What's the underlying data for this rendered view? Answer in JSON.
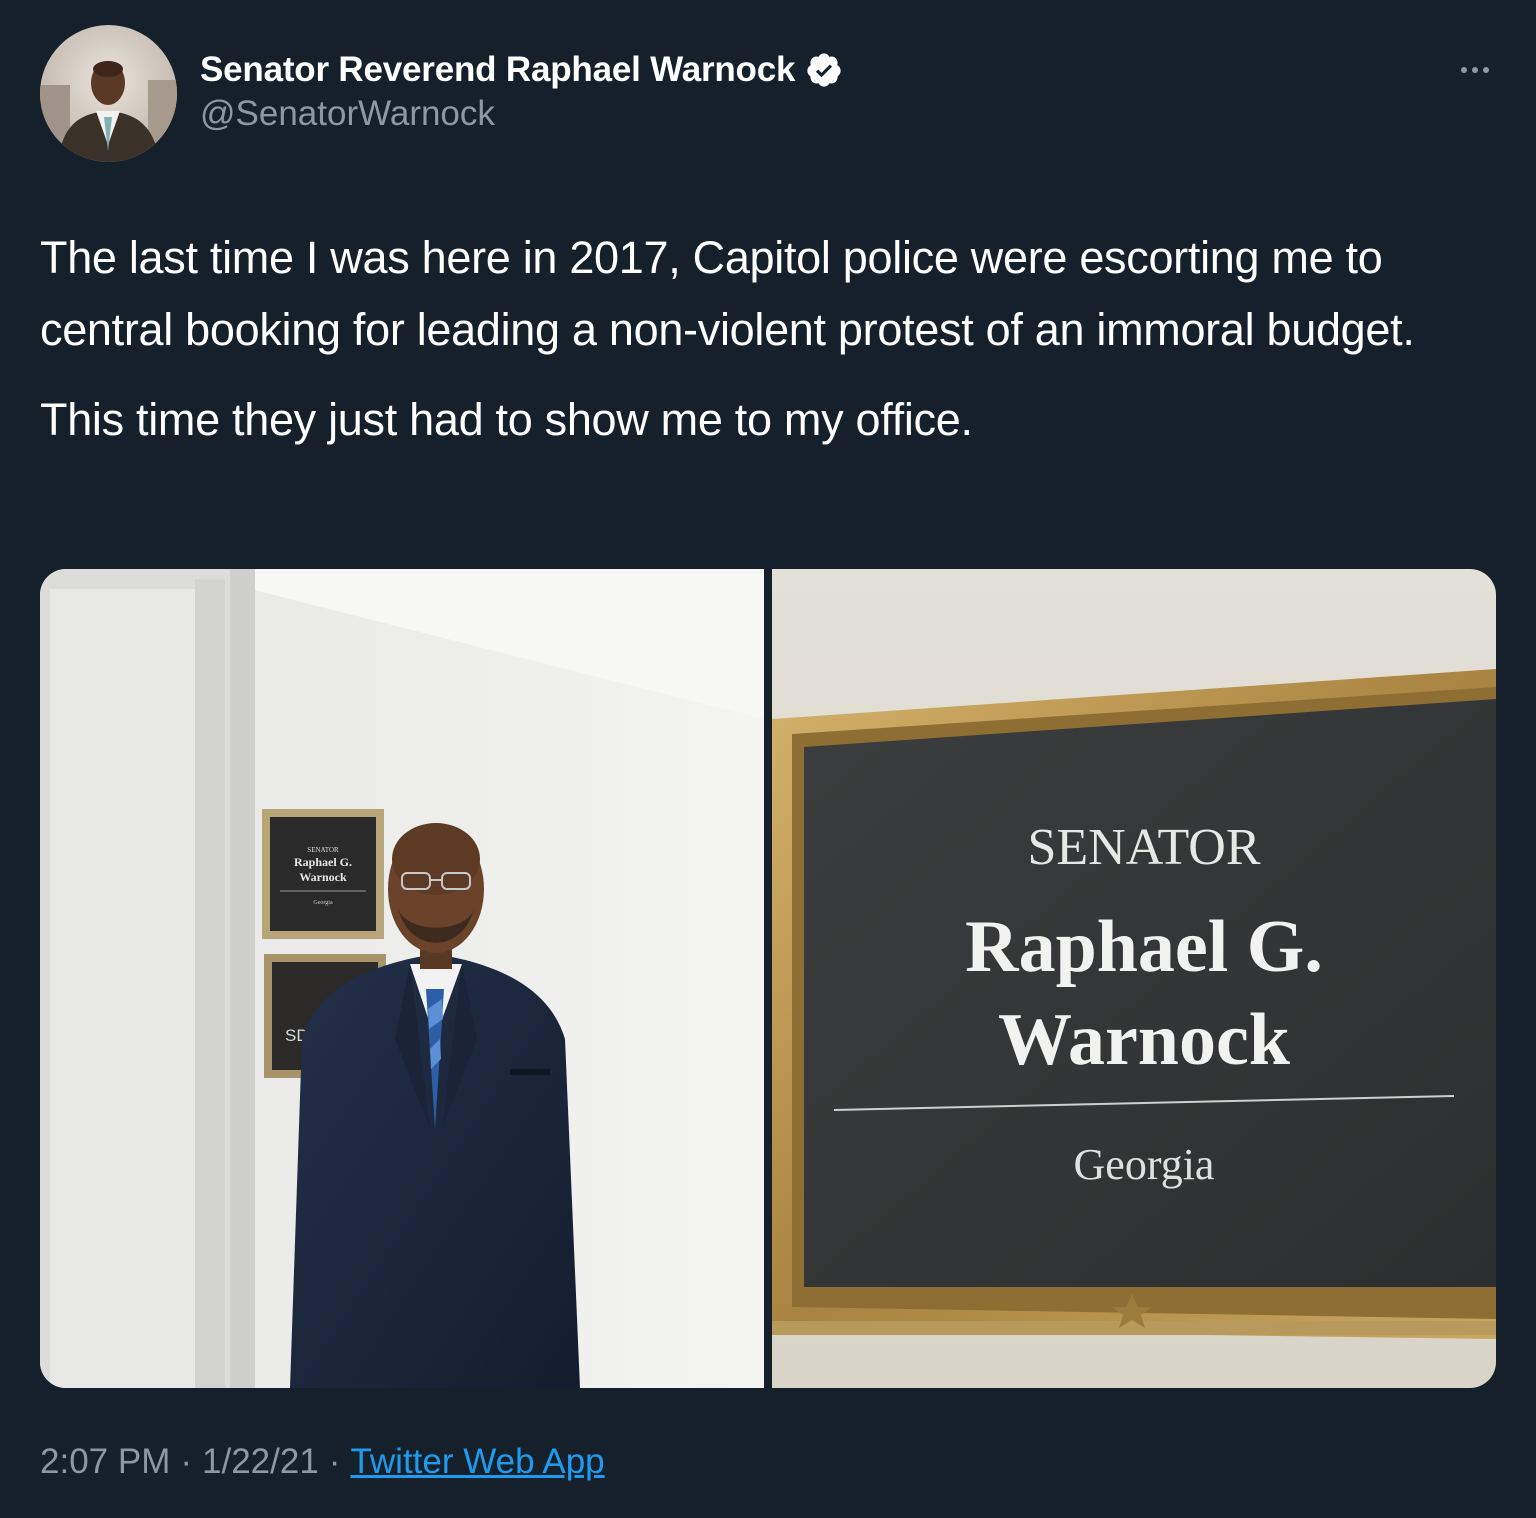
{
  "author": {
    "name": "Senator Reverend Raphael Warnock",
    "handle": "@SenatorWarnock",
    "verified": true,
    "avatar_icon": "profile-photo"
  },
  "tweet": {
    "paragraphs": [
      "The last time I was here in 2017, Capitol police were escorting me to central booking for leading a non-violent protest of an immoral budget.",
      "This time they just had to show me to my office."
    ]
  },
  "media": {
    "photo1": {
      "sign_top": {
        "title": "SENATOR",
        "line1": "Raphael G.",
        "line2": "Warnock",
        "state": "Georgia"
      },
      "sign_bottom": {
        "room": "SD-B"
      }
    },
    "photo2": {
      "sign": {
        "title": "SENATOR",
        "line1": "Raphael G.",
        "line2": "Warnock",
        "state": "Georgia"
      }
    }
  },
  "meta": {
    "time": "2:07 PM",
    "date": "1/22/21",
    "source": "Twitter Web App",
    "separator": "·"
  },
  "icons": {
    "verified": "verified-badge-icon",
    "more": "more-options-icon"
  },
  "colors": {
    "background": "#15202b",
    "text_primary": "#ffffff",
    "text_secondary": "#8b98a5",
    "link": "#1d9bf0"
  }
}
